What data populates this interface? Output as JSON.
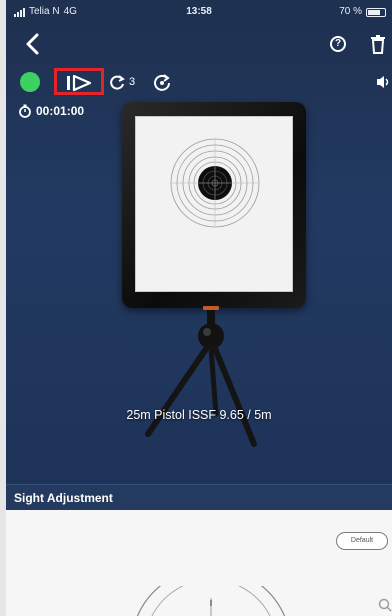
{
  "status_bar": {
    "carrier": "Telia N",
    "network": "4G",
    "time": "13:58",
    "battery": "70 %"
  },
  "toolbar": {
    "round_count": "3"
  },
  "session": {
    "timer": "00:01:00"
  },
  "target": {
    "caption": "25m Pistol ISSF 9.65 / 5m"
  },
  "sight_adjustment": {
    "title": "Sight Adjustment",
    "default_label": "Default"
  },
  "colors": {
    "status_dot": "#3dd162",
    "highlight_box": "#e5242a",
    "header_bg": "#1f3151"
  },
  "icons": {
    "back": "chevron-left-icon",
    "help": "question-circle-icon",
    "delete": "trash-icon",
    "play": "play-icon",
    "repeat": "repeat-icon",
    "reset": "reset-icon",
    "sound": "speaker-icon",
    "timer": "stopwatch-icon",
    "zoom": "zoom-icon"
  }
}
